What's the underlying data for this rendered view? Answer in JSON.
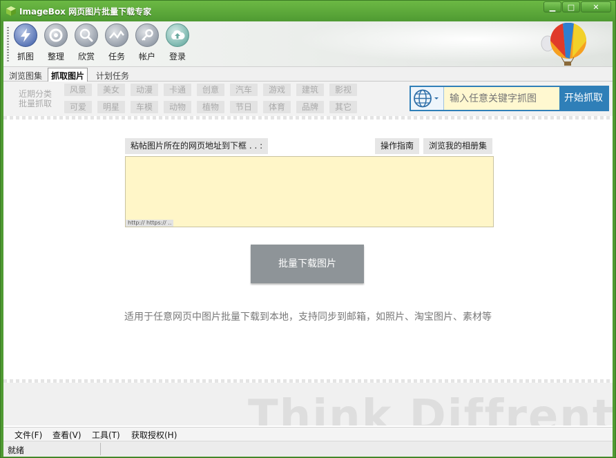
{
  "window": {
    "title": "ImageBox 网页图片批量下载专家",
    "minimize": "▁",
    "maximize": "□",
    "close": "✕"
  },
  "toolbar": {
    "items": [
      {
        "label": "抓图",
        "icon": "lightning-icon"
      },
      {
        "label": "整理",
        "icon": "eye-icon"
      },
      {
        "label": "欣赏",
        "icon": "magnifier-icon"
      },
      {
        "label": "任务",
        "icon": "wave-icon"
      },
      {
        "label": "帐户",
        "icon": "key-icon"
      },
      {
        "label": "登录",
        "icon": "cloud-upload-icon"
      }
    ]
  },
  "tabs": [
    {
      "label": "浏览图集",
      "active": false
    },
    {
      "label": "抓取图片",
      "active": true
    },
    {
      "label": "计划任务",
      "active": false
    }
  ],
  "categories": {
    "caption_line1": "近期分类",
    "caption_line2": "批量抓取",
    "row1": [
      "风景",
      "美女",
      "动漫",
      "卡通",
      "创意",
      "汽车",
      "游戏",
      "建筑",
      "影视"
    ],
    "row2": [
      "可爱",
      "明星",
      "车模",
      "动物",
      "植物",
      "节日",
      "体育",
      "品牌",
      "其它"
    ]
  },
  "search": {
    "placeholder": "输入任意关键字抓图",
    "button": "开始抓取"
  },
  "main": {
    "url_label": "粘帖图片所在的网页地址到下框 . . :",
    "guide_button": "操作指南",
    "album_button": "浏览我的相册集",
    "url_hint": "http:// https:// ..",
    "download_button": "批量下载图片",
    "description": "适用于任意网页中图片批量下载到本地，支持同步到邮箱，如照片、淘宝图片、素材等"
  },
  "banner": {
    "text": "Think Diffrent"
  },
  "menu": [
    "文件(F)",
    "查看(V)",
    "工具(T)",
    "获取授权(H)"
  ],
  "status": {
    "text": "就绪"
  },
  "colors": {
    "accent": "#2f7fb8",
    "title_green": "#4f9a32",
    "input_yellow": "#fff6c8"
  }
}
